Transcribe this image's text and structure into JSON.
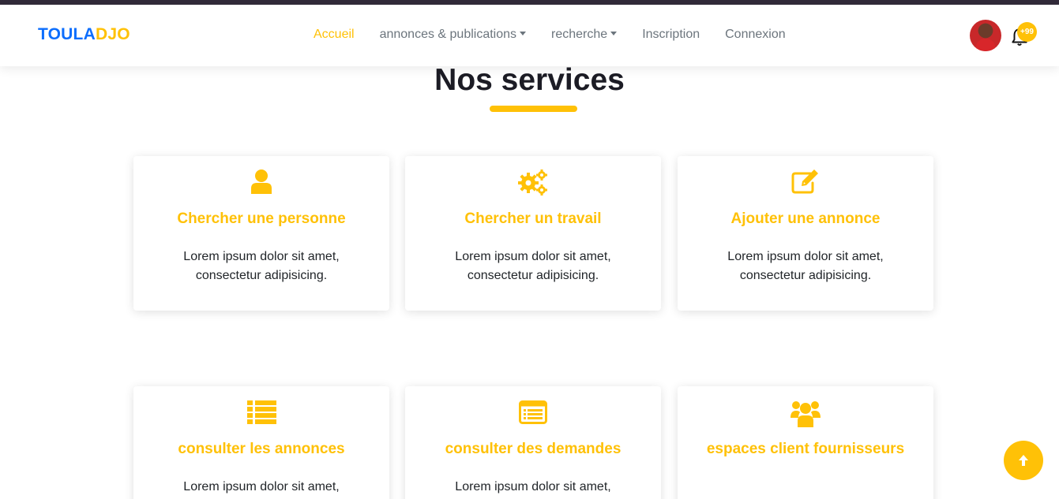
{
  "brand": {
    "part1": "TOULA",
    "part2": "DJO"
  },
  "nav": {
    "home": "Accueil",
    "ads": "annonces & publications",
    "search": "recherche",
    "signup": "Inscription",
    "login": "Connexion"
  },
  "notifications": {
    "count": "+99"
  },
  "services": {
    "title": "Nos services",
    "cards": [
      {
        "icon": "user-icon",
        "title": "Chercher une personne",
        "text": "Lorem ipsum dolor sit amet, consectetur adipisicing."
      },
      {
        "icon": "gears-icon",
        "title": "Chercher un travail",
        "text": "Lorem ipsum dolor sit amet, consectetur adipisicing."
      },
      {
        "icon": "edit-icon",
        "title": "Ajouter une annonce",
        "text": "Lorem ipsum dolor sit amet, consectetur adipisicing."
      },
      {
        "icon": "list-icon",
        "title": "consulter les annonces",
        "text": "Lorem ipsum dolor sit amet,"
      },
      {
        "icon": "newspaper-icon",
        "title": "consulter des demandes",
        "text": "Lorem ipsum dolor sit amet,"
      },
      {
        "icon": "users-icon",
        "title": "espaces client fournisseurs",
        "text": ""
      }
    ]
  },
  "colors": {
    "accent": "#ffc107",
    "brand_blue": "#0d6efd",
    "topbar": "#322b3a"
  }
}
